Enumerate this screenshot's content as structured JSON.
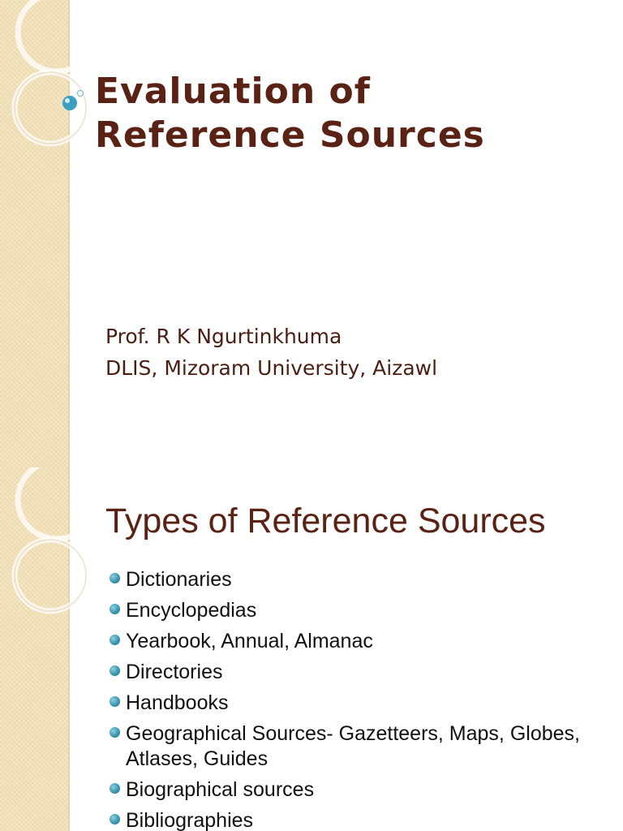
{
  "slide1": {
    "title_lines": [
      "Evaluation of",
      "Reference Sources"
    ],
    "subtitle_lines": [
      "Prof.  R K Ngurtinkhuma",
      "DLIS, Mizoram University, Aizawl"
    ]
  },
  "slide2": {
    "heading": "Types of Reference Sources",
    "bullets": [
      "Dictionaries",
      "Encyclopedias",
      "Yearbook,  Annual,  Almanac",
      "Directories",
      "Handbooks",
      "Geographical Sources- Gazetteers, Maps, Globes, Atlases, Guides",
      "Biographical sources",
      "Bibliographies"
    ]
  },
  "colors": {
    "title": "#5a2214",
    "strip": "#f1dfb6",
    "bullet": "#3a96b0"
  }
}
